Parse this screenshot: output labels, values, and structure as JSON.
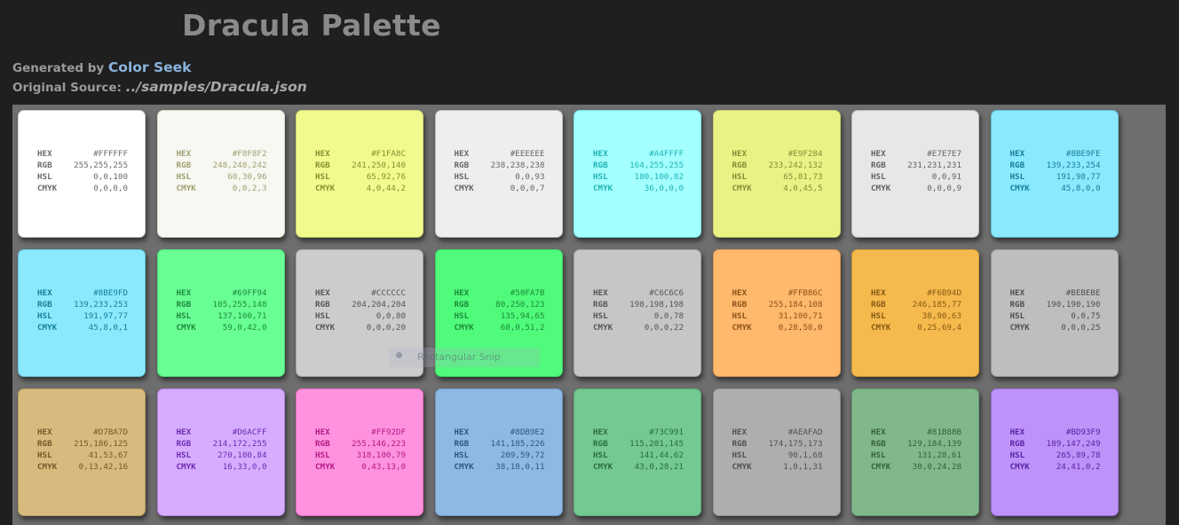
{
  "page": {
    "title": "Dracula Palette",
    "generated_prefix": "Generated by",
    "generated_link": "Color Seek",
    "source_prefix": "Original Source:",
    "source_path": "../samples/Dracula.json"
  },
  "labels": {
    "hex": "HEX",
    "rgb": "RGB",
    "hsl": "HSL",
    "cmyk": "CMYK"
  },
  "overlay": {
    "snip_label": "Rectangular Snip"
  },
  "swatches": [
    {
      "hex": "#FFFFFF",
      "rgb": "255,255,255",
      "hsl": "0,0,100",
      "cmyk": "0,0,0,0",
      "bg": "#FFFFFF",
      "text": "#6b6b6b"
    },
    {
      "hex": "#F8F8F2",
      "rgb": "248,248,242",
      "hsl": "60,30,96",
      "cmyk": "0,0,2,3",
      "bg": "#F8F8F2",
      "text": "#9e9e70"
    },
    {
      "hex": "#F1FA8C",
      "rgb": "241,250,140",
      "hsl": "65,92,76",
      "cmyk": "4,0,44,2",
      "bg": "#F1FA8C",
      "text": "#8a8d32"
    },
    {
      "hex": "#EEEEEE",
      "rgb": "238,238,238",
      "hsl": "0,0,93",
      "cmyk": "0,0,0,7",
      "bg": "#EEEEEE",
      "text": "#656565"
    },
    {
      "hex": "#A4FFFF",
      "rgb": "164,255,255",
      "hsl": "180,100,82",
      "cmyk": "36,0,0,0",
      "bg": "#A4FFFF",
      "text": "#1fb3b3"
    },
    {
      "hex": "#E9F284",
      "rgb": "233,242,132",
      "hsl": "65,81,73",
      "cmyk": "4,0,45,5",
      "bg": "#E9F284",
      "text": "#888b34"
    },
    {
      "hex": "#E7E7E7",
      "rgb": "231,231,231",
      "hsl": "0,0,91",
      "cmyk": "0,0,0,9",
      "bg": "#E7E7E7",
      "text": "#626262"
    },
    {
      "hex": "#8BE9FE",
      "rgb": "139,233,254",
      "hsl": "191,98,77",
      "cmyk": "45,8,0,0",
      "bg": "#8BE9FE",
      "text": "#177f96"
    },
    {
      "hex": "#8BE9FD",
      "rgb": "139,233,253",
      "hsl": "191,97,77",
      "cmyk": "45,8,0,1",
      "bg": "#8BE9FD",
      "text": "#177f96"
    },
    {
      "hex": "#69FF94",
      "rgb": "105,255,148",
      "hsl": "137,100,71",
      "cmyk": "59,0,42,0",
      "bg": "#69FF94",
      "text": "#1d8a3c"
    },
    {
      "hex": "#CCCCCC",
      "rgb": "204,204,204",
      "hsl": "0,0,80",
      "cmyk": "0,0,0,20",
      "bg": "#CCCCCC",
      "text": "#555555"
    },
    {
      "hex": "#50FA7B",
      "rgb": "80,250,123",
      "hsl": "135,94,65",
      "cmyk": "68,0,51,2",
      "bg": "#50FA7B",
      "text": "#1b8c39"
    },
    {
      "hex": "#C6C6C6",
      "rgb": "198,198,198",
      "hsl": "0,0,78",
      "cmyk": "0,0,0,22",
      "bg": "#C6C6C6",
      "text": "#555555"
    },
    {
      "hex": "#FFB86C",
      "rgb": "255,184,108",
      "hsl": "31,100,71",
      "cmyk": "0,28,58,0",
      "bg": "#FFB86C",
      "text": "#8d521a"
    },
    {
      "hex": "#F6B94D",
      "rgb": "246,185,77",
      "hsl": "38,90,63",
      "cmyk": "0,25,69,4",
      "bg": "#F6B94D",
      "text": "#855a14"
    },
    {
      "hex": "#BEBEBE",
      "rgb": "190,190,190",
      "hsl": "0,0,75",
      "cmyk": "0,0,0,25",
      "bg": "#BEBEBE",
      "text": "#4f4f4f"
    },
    {
      "hex": "#D7BA7D",
      "rgb": "215,186,125",
      "hsl": "41,53,67",
      "cmyk": "0,13,42,16",
      "bg": "#D7BA7D",
      "text": "#75592a"
    },
    {
      "hex": "#D6ACFF",
      "rgb": "214,172,255",
      "hsl": "270,100,84",
      "cmyk": "16,33,0,0",
      "bg": "#D6ACFF",
      "text": "#6b2bb0"
    },
    {
      "hex": "#FF92DF",
      "rgb": "255,146,223",
      "hsl": "318,100,79",
      "cmyk": "0,43,13,0",
      "bg": "#FF92DF",
      "text": "#b31a85"
    },
    {
      "hex": "#8DB9E2",
      "rgb": "141,185,226",
      "hsl": "209,59,72",
      "cmyk": "38,18,0,11",
      "bg": "#8DB9E2",
      "text": "#2e587d"
    },
    {
      "hex": "#73C991",
      "rgb": "115,201,145",
      "hsl": "141,44,62",
      "cmyk": "43,0,28,21",
      "bg": "#73C991",
      "text": "#2a6d42"
    },
    {
      "hex": "#AEAFAD",
      "rgb": "174,175,173",
      "hsl": "90,1,68",
      "cmyk": "1,0,1,31",
      "bg": "#AEAFAD",
      "text": "#505050"
    },
    {
      "hex": "#81B88B",
      "rgb": "129,184,139",
      "hsl": "131,28,61",
      "cmyk": "30,0,24,28",
      "bg": "#81B88B",
      "text": "#34603e"
    },
    {
      "hex": "#BD93F9",
      "rgb": "189,147,249",
      "hsl": "265,89,78",
      "cmyk": "24,41,0,2",
      "bg": "#BD93F9",
      "text": "#5a22a5"
    }
  ]
}
